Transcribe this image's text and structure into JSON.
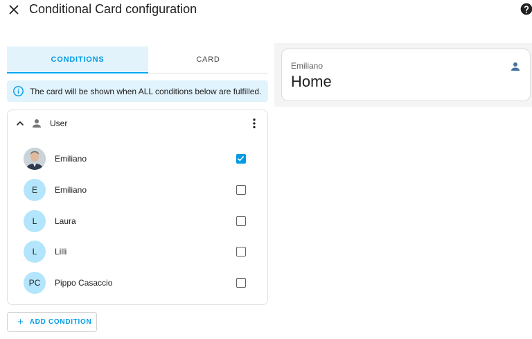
{
  "header": {
    "title": "Conditional Card configuration",
    "close_icon": "close-icon",
    "help_icon": "help-circle-icon"
  },
  "tabs": [
    {
      "label": "CONDITIONS",
      "active": true
    },
    {
      "label": "CARD",
      "active": false
    }
  ],
  "info": {
    "text": "The card will be shown when ALL conditions below are fulfilled.",
    "icon": "info-outline-icon"
  },
  "condition": {
    "title": "User",
    "icon": "account-icon",
    "users": [
      {
        "name": "Emiliano",
        "initials": "",
        "checked": true,
        "has_photo": true
      },
      {
        "name": "Emiliano",
        "initials": "E",
        "checked": false,
        "has_photo": false
      },
      {
        "name": "Laura",
        "initials": "L",
        "checked": false,
        "has_photo": false
      },
      {
        "name": "Lilli",
        "initials": "L",
        "checked": false,
        "has_photo": false
      },
      {
        "name": "Pippo Casaccio",
        "initials": "PC",
        "checked": false,
        "has_photo": false
      }
    ]
  },
  "add_condition": {
    "label": "ADD CONDITION",
    "icon": "plus-icon"
  },
  "preview": {
    "entity_name": "Emiliano",
    "entity_state": "Home",
    "icon": "account-icon"
  },
  "colors": {
    "accent": "#039be5",
    "avatar_bg": "#b3e5fc",
    "alert_bg": "#e1f3fd",
    "preview_bg": "#f4f4f4"
  }
}
